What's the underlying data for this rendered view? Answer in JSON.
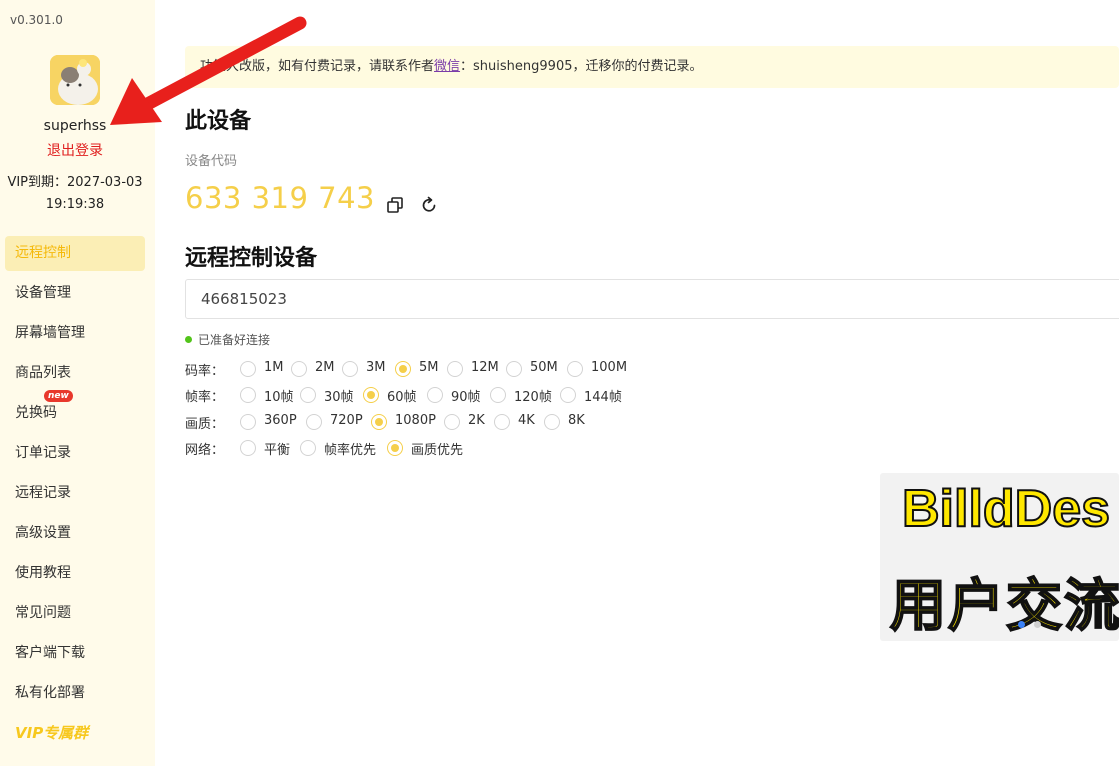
{
  "app": {
    "version": "v0.301.0"
  },
  "user": {
    "name": "superhss",
    "logout_label": "退出登录",
    "vip_expire": "VIP到期：2027-03-03 19:19:38"
  },
  "sidebar": {
    "items": [
      {
        "label": "远程控制",
        "active": true
      },
      {
        "label": "设备管理"
      },
      {
        "label": "屏幕墙管理"
      },
      {
        "label": "商品列表"
      },
      {
        "label": "兑换码",
        "badge": "new"
      },
      {
        "label": "订单记录"
      },
      {
        "label": "远程记录"
      },
      {
        "label": "高级设置"
      },
      {
        "label": "使用教程"
      },
      {
        "label": "常见问题"
      },
      {
        "label": "客户端下载"
      },
      {
        "label": "私有化部署"
      },
      {
        "label": "VIP专属群"
      }
    ]
  },
  "notice": {
    "prefix": "功能大改版，如有付费记录，请联系作者",
    "link": "微信",
    "suffix": "：shuisheng9905，迁移你的付费记录。"
  },
  "this_device": {
    "title": "此设备",
    "code_label": "设备代码",
    "code": "633 319 743"
  },
  "remote": {
    "title": "远程控制设备",
    "input_value": "466815023",
    "status": "已准备好连接"
  },
  "options": {
    "bitrate": {
      "label": "码率：",
      "values": [
        "1M",
        "2M",
        "3M",
        "5M",
        "12M",
        "50M",
        "100M"
      ],
      "selected": "5M"
    },
    "framerate": {
      "label": "帧率：",
      "values": [
        "10帧",
        "30帧",
        "60帧",
        "90帧",
        "120帧",
        "144帧"
      ],
      "selected": "60帧"
    },
    "quality": {
      "label": "画质：",
      "values": [
        "360P",
        "720P",
        "1080P",
        "2K",
        "4K",
        "8K"
      ],
      "selected": "1080P"
    },
    "network": {
      "label": "网络：",
      "values": [
        "平衡",
        "帧率优先",
        "画质优先"
      ],
      "selected": "画质优先"
    }
  },
  "banner": {
    "line1": "BilldDes",
    "line2": "用户交流"
  },
  "colors": {
    "accent": "#f5cf4a",
    "sidebar_bg": "#fffbea",
    "danger": "#e02020",
    "annotation": "#e8201c"
  }
}
